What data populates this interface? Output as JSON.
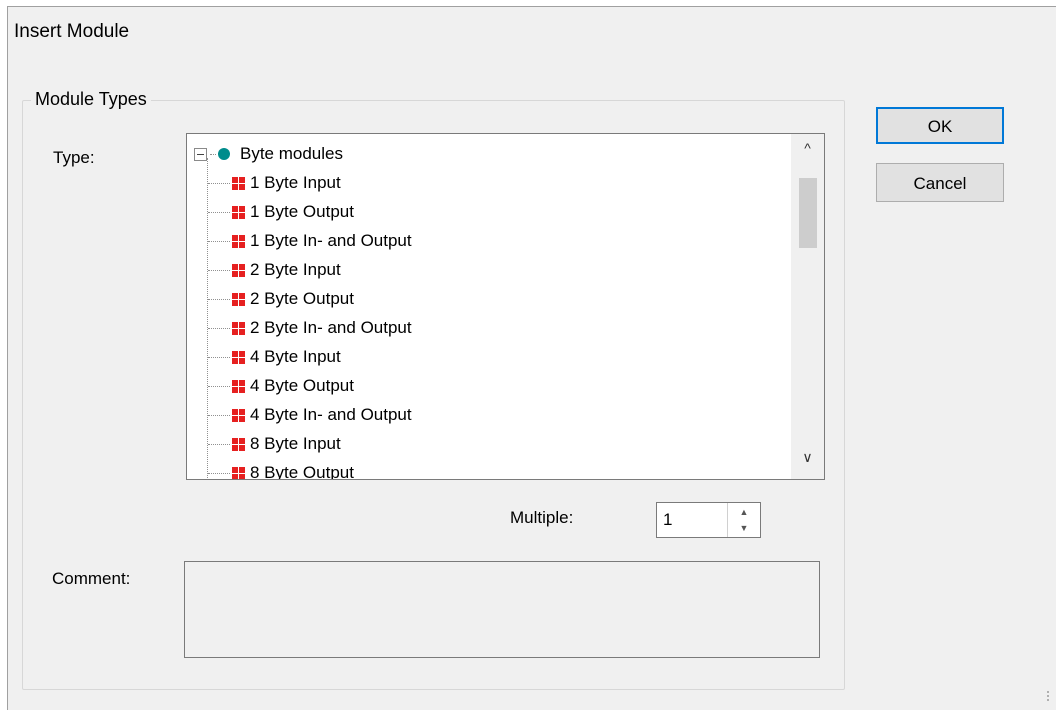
{
  "dialog": {
    "title": "Insert Module"
  },
  "groupbox": {
    "label": "Module Types"
  },
  "type_label": "Type:",
  "tree": {
    "root": "Byte modules",
    "items": [
      "1 Byte Input",
      "1 Byte Output",
      "1 Byte In- and Output",
      "2 Byte Input",
      "2 Byte Output",
      "2 Byte In- and Output",
      "4 Byte Input",
      "4 Byte Output",
      "4 Byte In- and Output",
      "8 Byte Input",
      "8 Byte Output"
    ]
  },
  "scrollbar": {
    "up_glyph": "^",
    "down_glyph": "∨"
  },
  "multiple": {
    "label": "Multiple:",
    "value": "1",
    "up_glyph": "▲",
    "down_glyph": "▼"
  },
  "comment": {
    "label": "Comment:",
    "value": ""
  },
  "buttons": {
    "ok": "OK",
    "cancel": "Cancel"
  },
  "colors": {
    "module_icon": "#e62020",
    "root_icon": "#008c8c",
    "default_button_border": "#0078d7"
  },
  "icons": {
    "root": "module-group-icon",
    "item": "byte-module-icon"
  }
}
